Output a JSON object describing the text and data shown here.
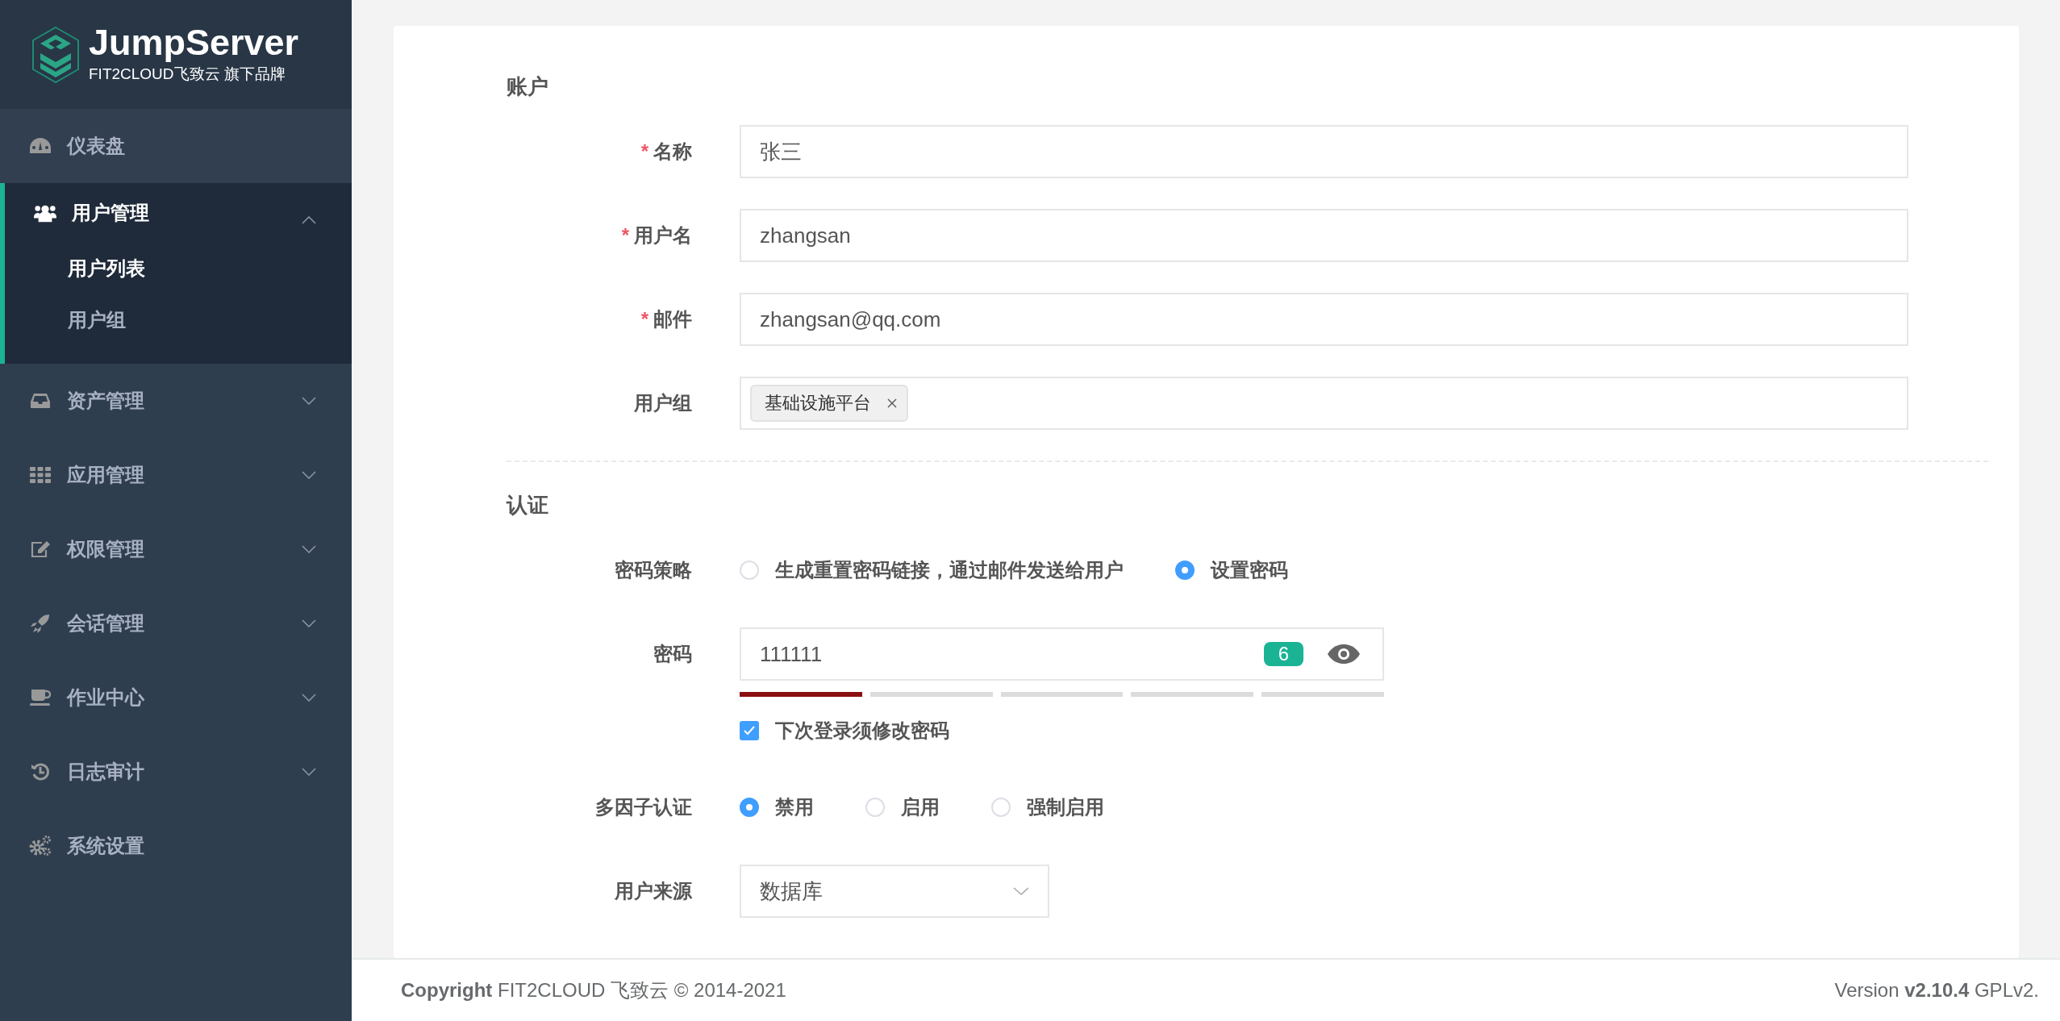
{
  "logo": {
    "name": "JumpServer",
    "tagline": "FIT2CLOUD飞致云 旗下品牌"
  },
  "sidebar": {
    "items": [
      {
        "kind": "link",
        "label": "仪表盘"
      },
      {
        "kind": "group",
        "label": "用户管理",
        "expanded": true,
        "children": [
          {
            "label": "用户列表",
            "selected": true
          },
          {
            "label": "用户组",
            "selected": false
          }
        ]
      },
      {
        "kind": "group",
        "label": "资产管理",
        "expanded": false
      },
      {
        "kind": "group",
        "label": "应用管理",
        "expanded": false
      },
      {
        "kind": "group",
        "label": "权限管理",
        "expanded": false
      },
      {
        "kind": "group",
        "label": "会话管理",
        "expanded": false
      },
      {
        "kind": "group",
        "label": "作业中心",
        "expanded": false
      },
      {
        "kind": "group",
        "label": "日志审计",
        "expanded": false
      },
      {
        "kind": "link",
        "label": "系统设置"
      }
    ]
  },
  "form": {
    "required_mark": "*",
    "sections": [
      {
        "title": "账户",
        "fields": [
          {
            "kind": "text",
            "label": "名称",
            "required": true,
            "value": "张三"
          },
          {
            "kind": "text",
            "label": "用户名",
            "required": true,
            "value": "zhangsan"
          },
          {
            "kind": "text",
            "label": "邮件",
            "required": true,
            "value": "zhangsan@qq.com"
          },
          {
            "kind": "tags",
            "label": "用户组",
            "required": false,
            "tags": [
              "基础设施平台"
            ]
          }
        ]
      },
      {
        "title": "认证",
        "fields": [
          {
            "kind": "radio",
            "label": "密码策略",
            "required": false,
            "options": [
              {
                "label": "生成重置密码链接，通过邮件发送给用户",
                "selected": false
              },
              {
                "label": "设置密码",
                "selected": true
              }
            ]
          },
          {
            "kind": "password",
            "label": "密码",
            "required": false,
            "value": "111111",
            "length_badge": "6",
            "level": 0.2
          },
          {
            "kind": "checkbox",
            "label": "下次登录须修改密码",
            "checked": true
          },
          {
            "kind": "radio",
            "label": "多因子认证",
            "required": false,
            "options": [
              {
                "label": "禁用",
                "selected": true
              },
              {
                "label": "启用",
                "selected": false
              },
              {
                "label": "强制启用",
                "selected": false
              }
            ]
          },
          {
            "kind": "select",
            "label": "用户来源",
            "required": false,
            "value": "数据库"
          }
        ]
      }
    ]
  },
  "footer": {
    "copyright": "**Copyright** FIT2CLOUD 飞致云 © 2014-2021",
    "version": "Version **v2.10.4** GPLv2."
  }
}
